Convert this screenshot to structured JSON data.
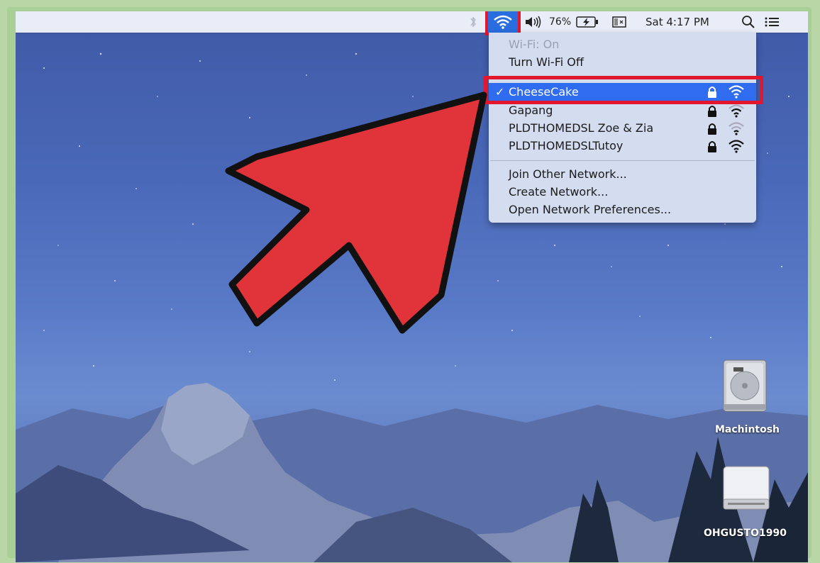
{
  "menubar": {
    "bluetooth_icon": "bluetooth-icon",
    "wifi_icon": "wifi-icon",
    "volume_icon": "volume-icon",
    "battery_percent": "76%",
    "battery_icon": "battery-charging-icon",
    "display_icon": "display-icon",
    "clock": "Sat 4:17 PM",
    "search_icon": "spotlight-search-icon",
    "list_icon": "notification-center-icon"
  },
  "wifi_menu": {
    "status": "Wi-Fi: On",
    "toggle_label": "Turn Wi-Fi Off",
    "networks": [
      {
        "name": "CheeseCake",
        "selected": true,
        "checkmark": "✓",
        "locked": true,
        "signal": 3
      },
      {
        "name": "Gapang",
        "selected": false,
        "locked": true,
        "signal": 2
      },
      {
        "name": "PLDTHOMEDSL Zoe & Zia",
        "selected": false,
        "locked": true,
        "signal": 1
      },
      {
        "name": "PLDTHOMEDSLTutoy",
        "selected": false,
        "locked": true,
        "signal": 3
      }
    ],
    "actions": {
      "join_other": "Join Other Network...",
      "create": "Create Network...",
      "open_prefs": "Open Network Preferences..."
    }
  },
  "desktop": {
    "drives": [
      {
        "label": "Machintosh",
        "icon": "hard-drive-icon"
      },
      {
        "label": "OHGUSTO1990",
        "icon": "external-drive-icon"
      }
    ]
  },
  "colors": {
    "highlight": "#2f6cf0",
    "annotation_red": "#e2162c",
    "arrow_fill": "#e0343a"
  }
}
